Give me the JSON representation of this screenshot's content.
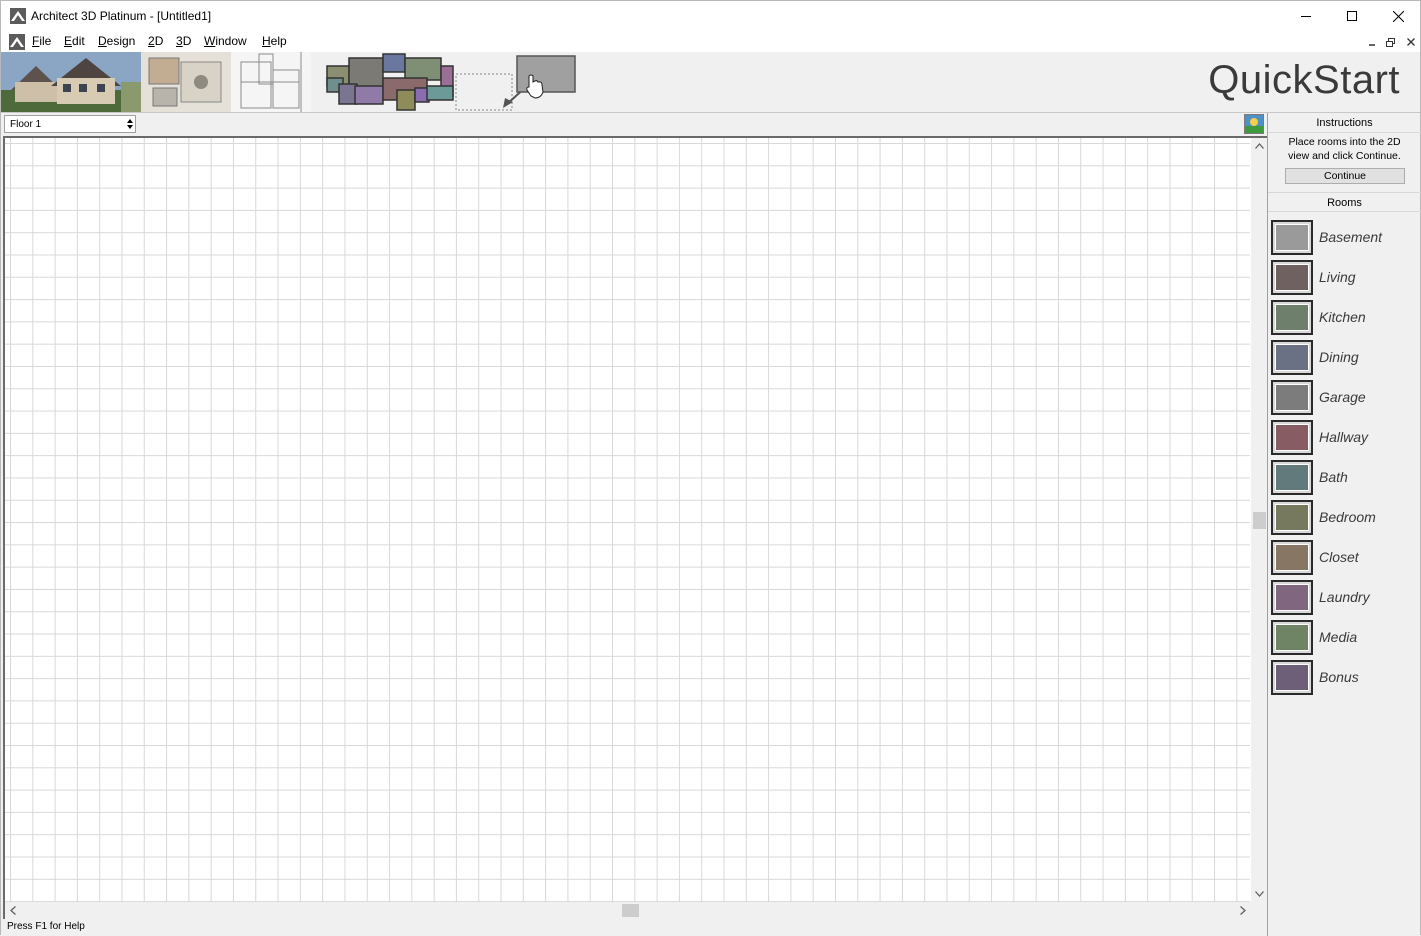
{
  "window": {
    "title": "Architect 3D Platinum - [Untitled1]"
  },
  "menu": {
    "items": [
      {
        "label": "File",
        "accel": "F",
        "rest": "ile"
      },
      {
        "label": "Edit",
        "accel": "E",
        "rest": "dit"
      },
      {
        "label": "Design",
        "accel": "D",
        "rest": "esign"
      },
      {
        "label": "2D",
        "accel": "2",
        "rest": "D"
      },
      {
        "label": "3D",
        "accel": "3",
        "rest": "D"
      },
      {
        "label": "Window",
        "accel": "W",
        "rest": "indow"
      },
      {
        "label": "Help",
        "accel": "H",
        "rest": "elp"
      }
    ]
  },
  "banner": {
    "title": "QuickStart"
  },
  "floor": {
    "selected": "Floor 1"
  },
  "status": {
    "text": "Press F1 for Help"
  },
  "panel": {
    "instructions_header": "Instructions",
    "instructions_text_line1": "Place rooms into the 2D",
    "instructions_text_line2": "view and click Continue.",
    "continue_label": "Continue",
    "rooms_header": "Rooms",
    "rooms": [
      {
        "label": "Basement",
        "color": "#9a9a9a"
      },
      {
        "label": "Living",
        "color": "#6e615f"
      },
      {
        "label": "Kitchen",
        "color": "#6e7f6c"
      },
      {
        "label": "Dining",
        "color": "#6a7184"
      },
      {
        "label": "Garage",
        "color": "#7c7c7c"
      },
      {
        "label": "Hallway",
        "color": "#875c62"
      },
      {
        "label": "Bath",
        "color": "#627a7b"
      },
      {
        "label": "Bedroom",
        "color": "#77795f"
      },
      {
        "label": "Closet",
        "color": "#877663"
      },
      {
        "label": "Laundry",
        "color": "#80667f"
      },
      {
        "label": "Media",
        "color": "#6f8464"
      },
      {
        "label": "Bonus",
        "color": "#6e5f78"
      }
    ]
  }
}
